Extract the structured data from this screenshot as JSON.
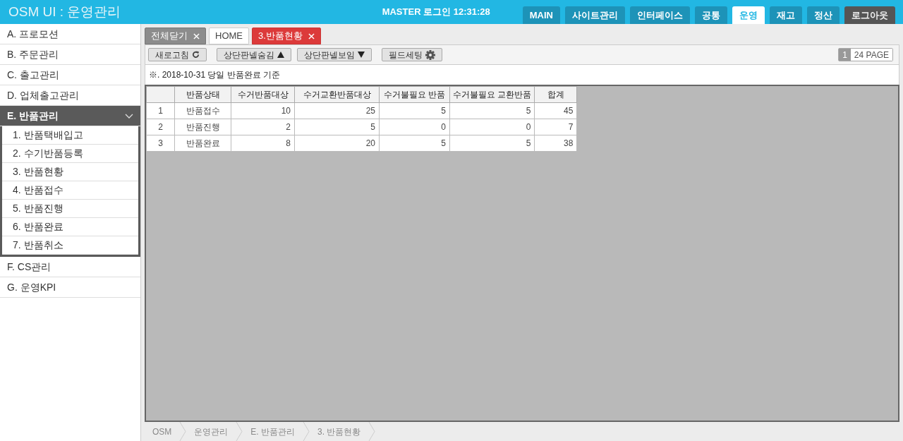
{
  "header": {
    "title": "OSM UI : 운영관리",
    "login": "MASTER 로그인 12:31:28",
    "nav": [
      {
        "label": "MAIN",
        "selected": false,
        "kind": "menu"
      },
      {
        "label": "사이트관리",
        "selected": false,
        "kind": "menu"
      },
      {
        "label": "인터페이스",
        "selected": false,
        "kind": "menu"
      },
      {
        "label": "공통",
        "selected": false,
        "kind": "menu"
      },
      {
        "label": "운영",
        "selected": true,
        "kind": "menu"
      },
      {
        "label": "재고",
        "selected": false,
        "kind": "menu"
      },
      {
        "label": "정산",
        "selected": false,
        "kind": "menu"
      },
      {
        "label": "로그아웃",
        "selected": false,
        "kind": "logout"
      }
    ]
  },
  "sidebar": {
    "items": [
      {
        "label": "A. 프로모션",
        "expanded": false
      },
      {
        "label": "B. 주문관리",
        "expanded": false
      },
      {
        "label": "C. 출고관리",
        "expanded": false
      },
      {
        "label": "D. 업체출고관리",
        "expanded": false
      },
      {
        "label": "E. 반품관리",
        "expanded": true,
        "children": [
          {
            "label": "1. 반품택배입고"
          },
          {
            "label": "2. 수기반품등록"
          },
          {
            "label": "3. 반품현황"
          },
          {
            "label": "4. 반품접수"
          },
          {
            "label": "5. 반품진행"
          },
          {
            "label": "6. 반품완료"
          },
          {
            "label": "7. 반품취소"
          }
        ]
      },
      {
        "label": "F. CS관리",
        "expanded": false
      },
      {
        "label": "G. 운영KPI",
        "expanded": false
      }
    ]
  },
  "tabs": [
    {
      "label": "전체닫기",
      "kind": "closeall",
      "selected": false
    },
    {
      "label": "HOME",
      "kind": "home",
      "selected": false
    },
    {
      "label": "3.반품현황",
      "kind": "page",
      "selected": true
    }
  ],
  "toolbar": {
    "buttons": [
      {
        "label": "새로고침",
        "kind": "refresh"
      },
      {
        "label": "상단판넬숨김",
        "kind": "hide"
      },
      {
        "label": "상단판넬보임",
        "kind": "show"
      },
      {
        "label": "필드세팅",
        "kind": "settings"
      }
    ],
    "page": "1",
    "page_label": "24 PAGE"
  },
  "note": "※. 2018-10-31 당일 반품완료 기준",
  "table": {
    "columns": [
      "",
      "반품상태",
      "수거반품대상",
      "수거교환반품대상",
      "수거불필요 반품",
      "수거불필요 교환반품",
      "합계"
    ],
    "rows": [
      [
        "1",
        "반품접수",
        "10",
        "25",
        "5",
        "5",
        "45"
      ],
      [
        "2",
        "반품진행",
        "2",
        "5",
        "0",
        "0",
        "7"
      ],
      [
        "3",
        "반품완료",
        "8",
        "20",
        "5",
        "5",
        "38"
      ]
    ]
  },
  "breadcrumb": [
    "OSM",
    "운영관리",
    "E. 반품관리",
    "3. 반품현황"
  ]
}
